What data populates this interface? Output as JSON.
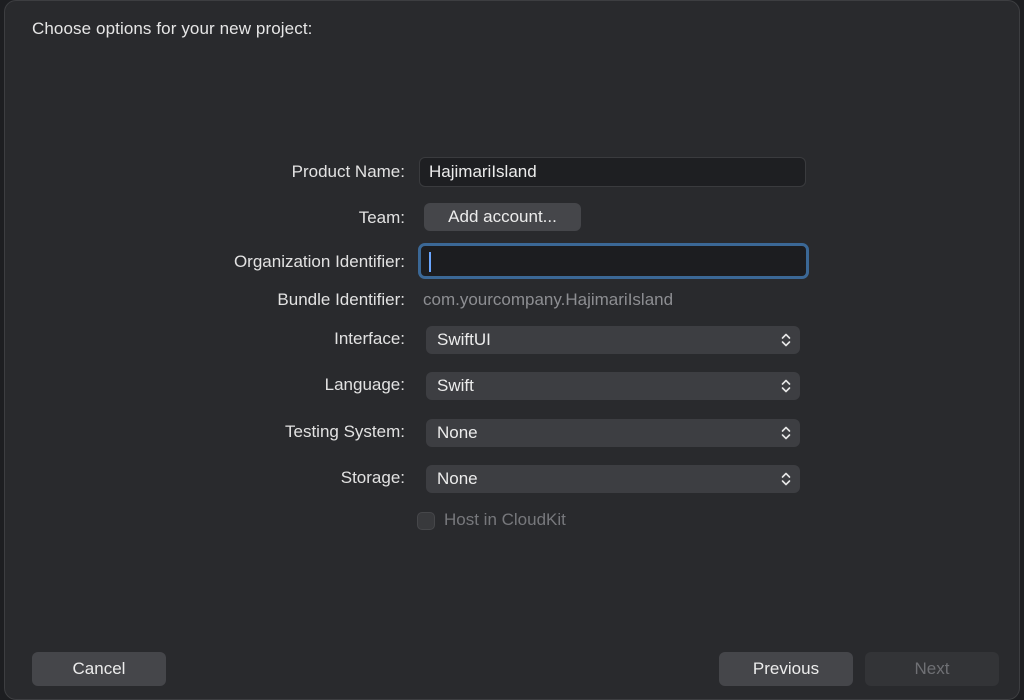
{
  "dialog": {
    "title": "Choose options for your new project:"
  },
  "form": {
    "product_name": {
      "label": "Product Name:",
      "value": "HajimariIsland"
    },
    "team": {
      "label": "Team:",
      "button_label": "Add account..."
    },
    "organization_identifier": {
      "label": "Organization Identifier:",
      "value": ""
    },
    "bundle_identifier": {
      "label": "Bundle Identifier:",
      "value": "com.yourcompany.HajimariIsland"
    },
    "interface": {
      "label": "Interface:",
      "selected": "SwiftUI"
    },
    "language": {
      "label": "Language:",
      "selected": "Swift"
    },
    "testing_system": {
      "label": "Testing System:",
      "selected": "None"
    },
    "storage": {
      "label": "Storage:",
      "selected": "None"
    },
    "host_in_cloudkit": {
      "label": "Host in CloudKit",
      "checked": false,
      "enabled": false
    }
  },
  "footer": {
    "cancel_label": "Cancel",
    "previous_label": "Previous",
    "next_label": "Next"
  },
  "icons": {
    "popup_indicator": "chevron-up-down-icon"
  },
  "colors": {
    "window_bg": "#292a2d",
    "focus_ring": "#3b6896",
    "button_bg": "#45464a",
    "popup_bg": "#3d3e42"
  }
}
